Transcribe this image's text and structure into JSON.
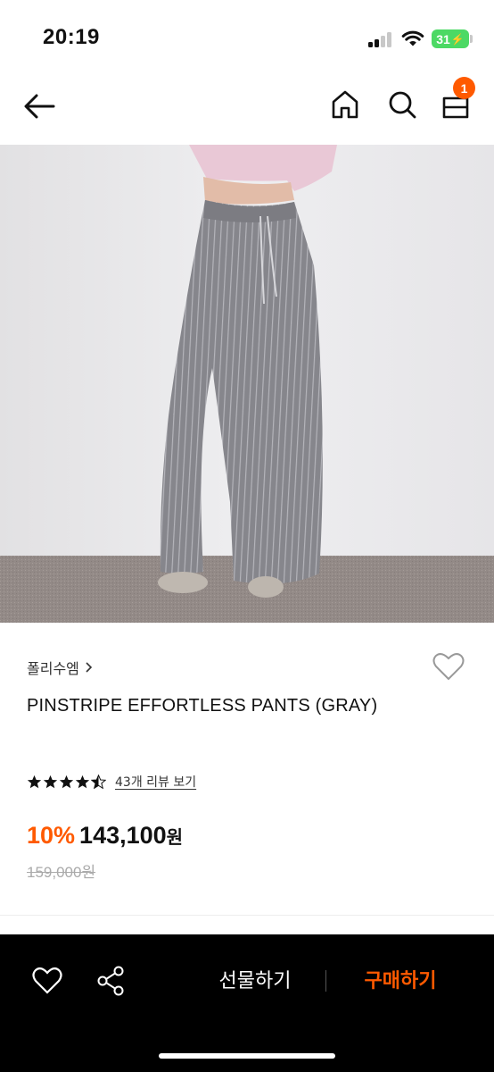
{
  "status_bar": {
    "time": "20:19",
    "battery": "31",
    "icons": [
      "signal-icon",
      "wifi-icon",
      "battery-icon"
    ]
  },
  "nav": {
    "icons": [
      "back-arrow-icon",
      "home-icon",
      "search-icon",
      "cart-icon"
    ],
    "cart_count": "1"
  },
  "product": {
    "image_description_icon": "product-photo",
    "brand": "폴리수엠",
    "brand_chevron": ">",
    "title": "PINSTRIPE EFFORTLESS PANTS (GRAY)",
    "rating": 4.5,
    "rating_max": 5,
    "review_link": "43개 리뷰 보기",
    "discount": "10%",
    "sale_price": "143,100",
    "sale_unit": "원",
    "original_price": "159,000원"
  },
  "bottom_bar": {
    "gift_label": "선물하기",
    "buy_label": "구매하기",
    "icons": [
      "heart-icon",
      "share-icon"
    ]
  },
  "colors": {
    "accent": "#ff5a00",
    "battery": "#4cd964",
    "bottom_bar": "#000000"
  }
}
